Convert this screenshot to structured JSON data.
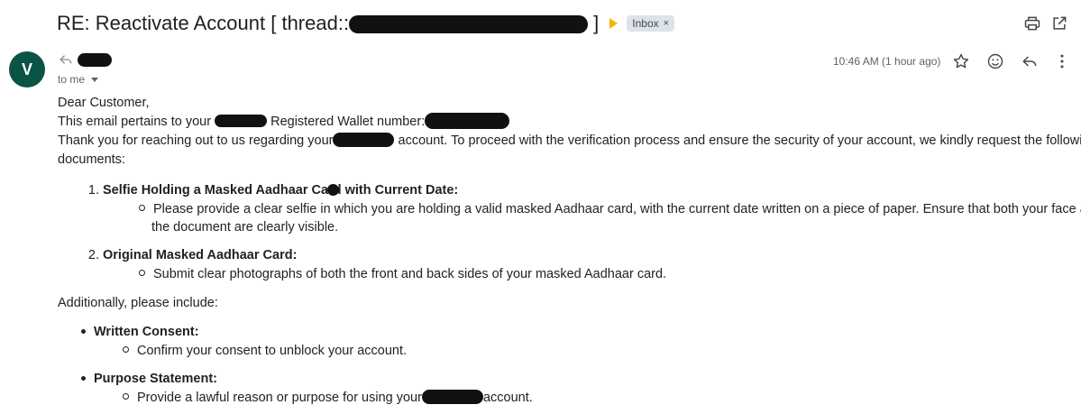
{
  "subject": {
    "prefix": "RE: Reactivate Account [ thread::",
    "suffix": " ]",
    "label": "Inbox",
    "label_remove": "×"
  },
  "message": {
    "avatar_letter": "V",
    "to_me": "to me",
    "timestamp": "10:46 AM (1 hour ago)"
  },
  "body": {
    "greeting": "Dear Customer,",
    "line1_a": "This email pertains to your",
    "line1_b": "Registered Wallet number:",
    "line2_a": "Thank you for reaching out to us regarding your",
    "line2_b": "account. To proceed with the verification process and ensure the security of your account, we kindly request the following",
    "line3": "documents:",
    "item1_num": "1.",
    "item1_title": "Selfie Holding a Masked Aadhaar Card with Current Date:",
    "item1_sub_l1": "Please provide a clear selfie in which you are holding a valid masked Aadhaar card, with the current date written on a piece of paper. Ensure that both your face and",
    "item1_sub_l2": "the document are clearly visible.",
    "item2_num": "2.",
    "item2_title": "Original Masked Aadhaar Card:",
    "item2_sub": "Submit clear photographs of both the front and back sides of your masked Aadhaar card.",
    "additionally": "Additionally, please include:",
    "bullet1_title": "Written Consent:",
    "bullet1_sub": "Confirm your consent to unblock your account.",
    "bullet2_title": "Purpose Statement:",
    "bullet2_sub_a": "Provide a lawful reason or purpose for using your",
    "bullet2_sub_b": "account."
  },
  "icons": {
    "print": "print-icon",
    "open_new_window": "open-in-new-window-icon",
    "reply_small": "reply-icon",
    "star": "star-icon",
    "emoji": "add-reaction-icon",
    "reply": "reply-icon",
    "more": "more-vert-icon"
  },
  "colors": {
    "avatar_bg": "#0b5345",
    "importance_marker": "#f4b400",
    "label_chip_bg": "#dde3ea",
    "redaction": "#111111"
  }
}
